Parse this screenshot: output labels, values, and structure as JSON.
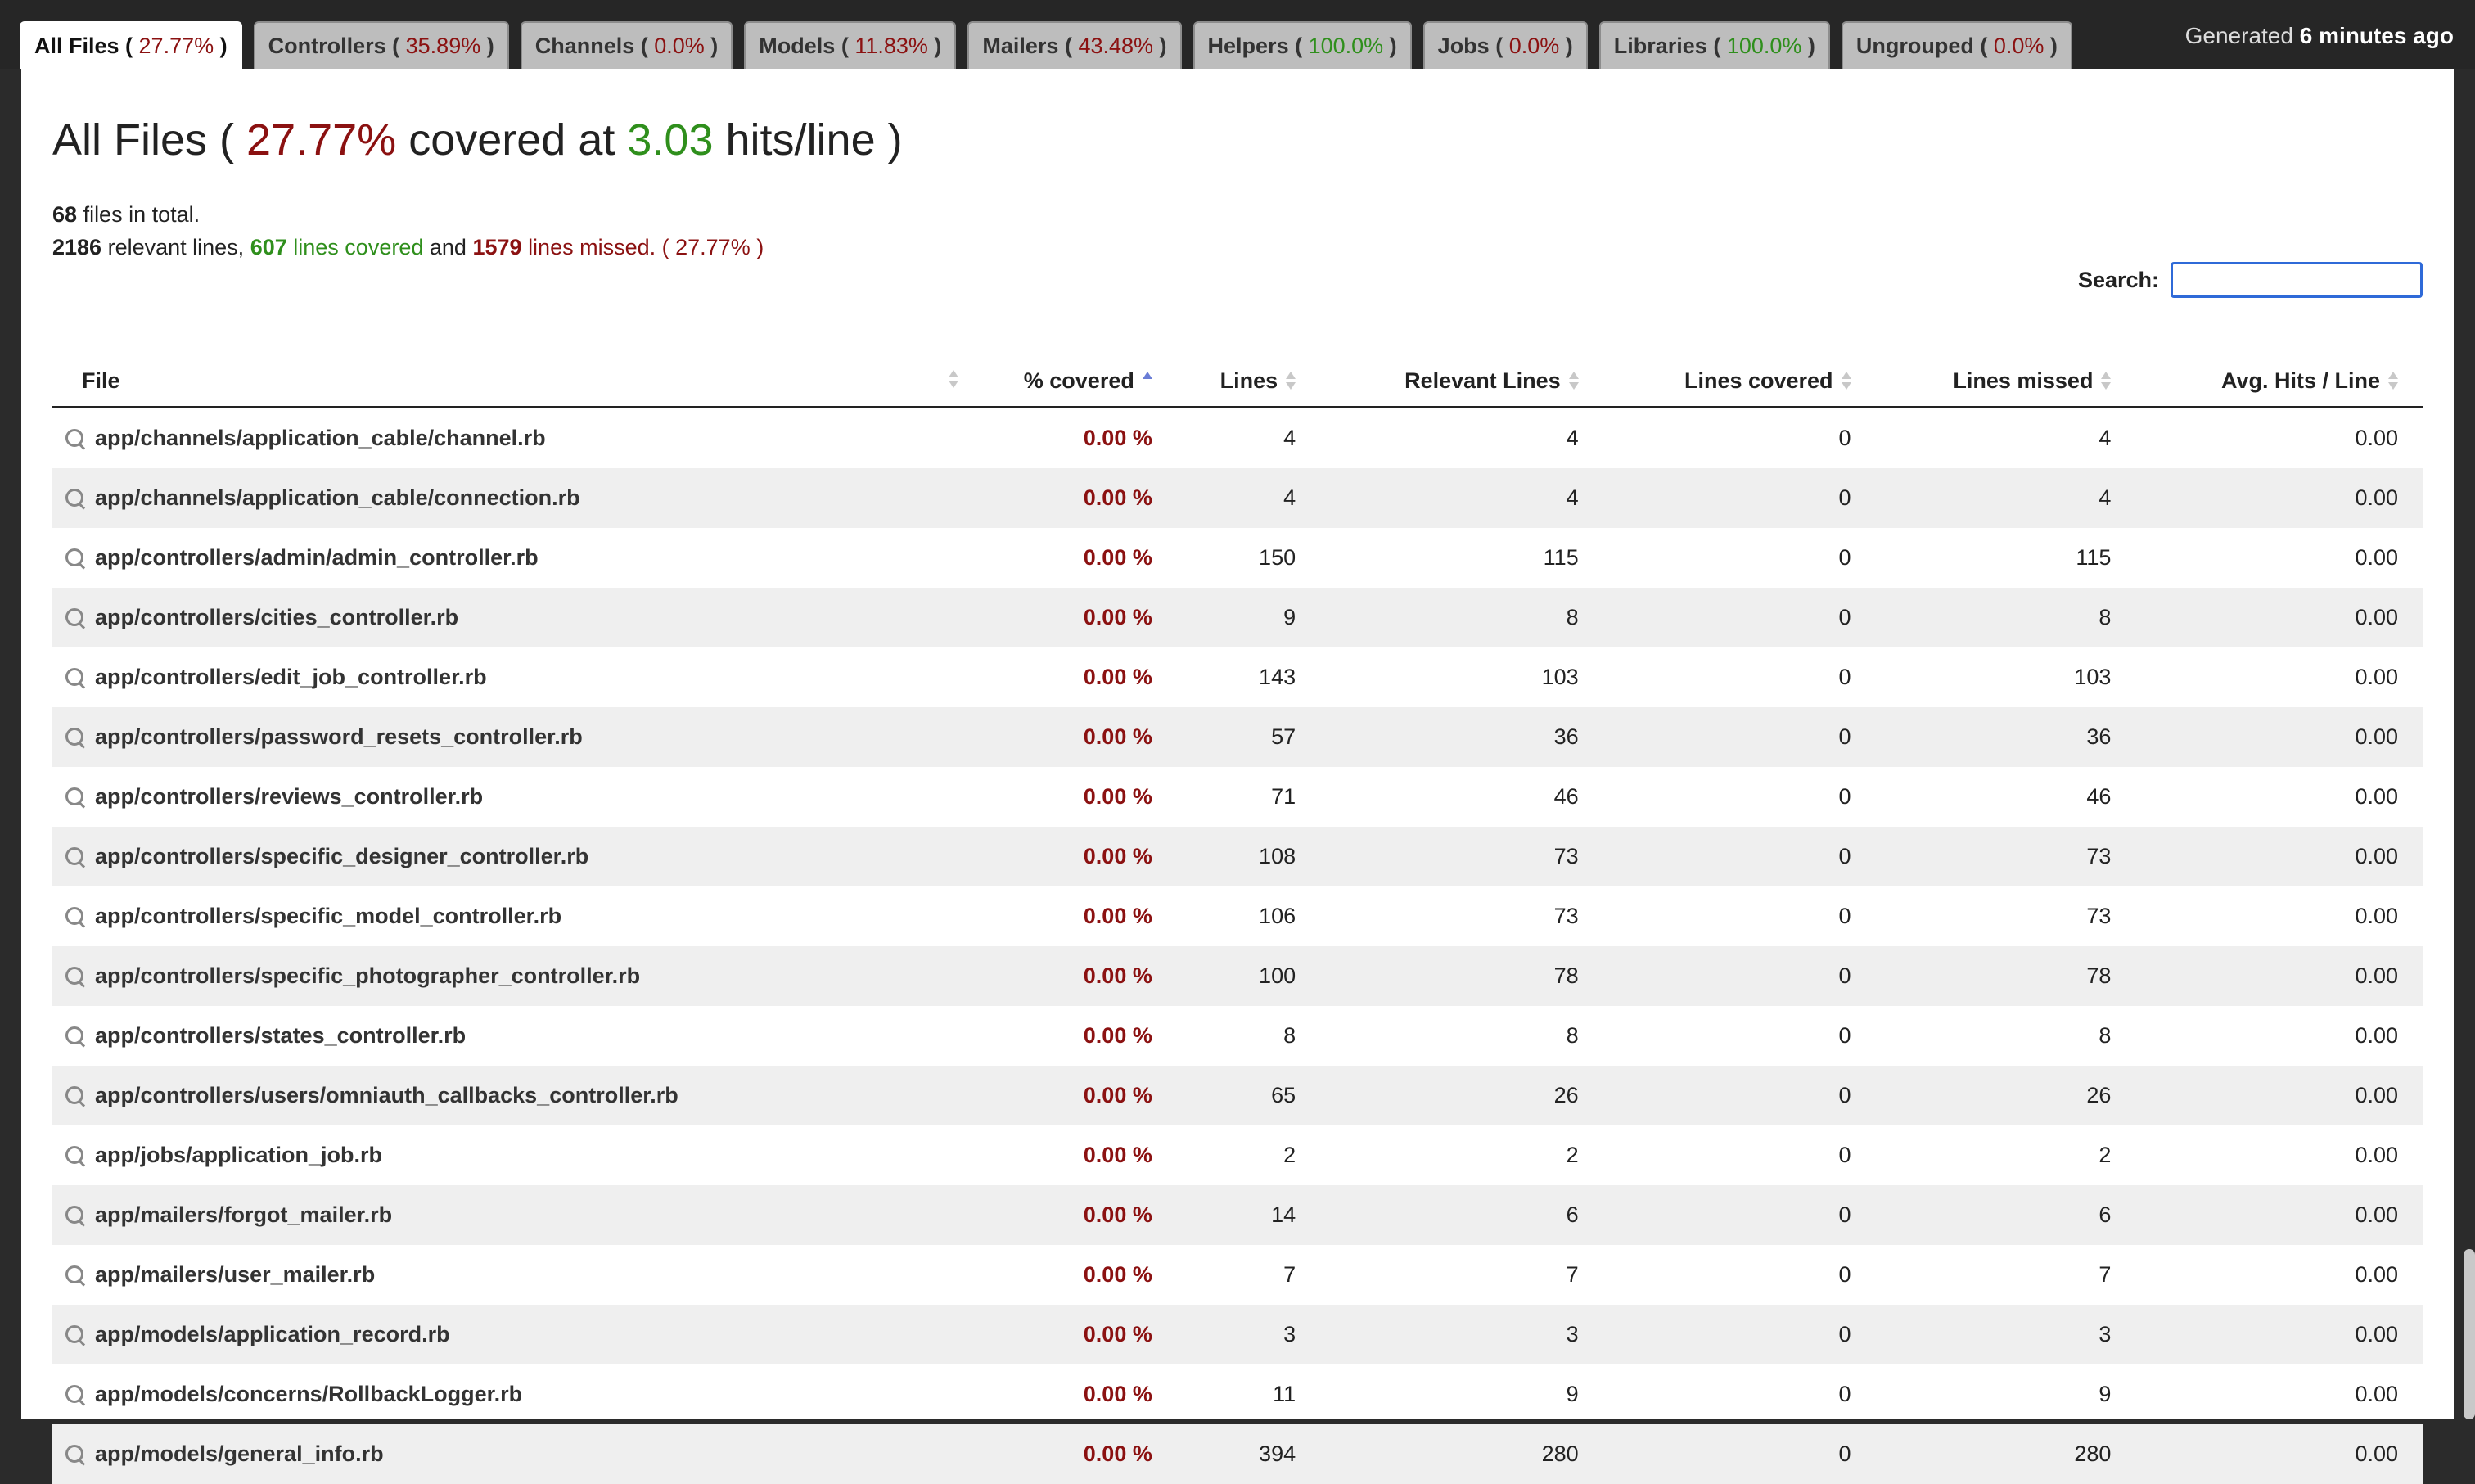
{
  "tabs": [
    {
      "name": "All Files",
      "pct": "27.77%",
      "status": "red",
      "active": true
    },
    {
      "name": "Controllers",
      "pct": "35.89%",
      "status": "red",
      "active": false
    },
    {
      "name": "Channels",
      "pct": "0.0%",
      "status": "red",
      "active": false
    },
    {
      "name": "Models",
      "pct": "11.83%",
      "status": "red",
      "active": false
    },
    {
      "name": "Mailers",
      "pct": "43.48%",
      "status": "red",
      "active": false
    },
    {
      "name": "Helpers",
      "pct": "100.0%",
      "status": "green",
      "active": false
    },
    {
      "name": "Jobs",
      "pct": "0.0%",
      "status": "red",
      "active": false
    },
    {
      "name": "Libraries",
      "pct": "100.0%",
      "status": "green",
      "active": false
    },
    {
      "name": "Ungrouped",
      "pct": "0.0%",
      "status": "red",
      "active": false
    }
  ],
  "generated": {
    "prefix": "Generated",
    "value": "6 minutes ago"
  },
  "heading": {
    "title": "All Files",
    "open": "(",
    "covered_pct": "27.77%",
    "covered_at": "covered at",
    "hits": "3.03",
    "hits_unit": "hits/line",
    "close": ")"
  },
  "summary": {
    "files_count": "68",
    "files_text": "files in total.",
    "relevant_count": "2186",
    "relevant_text": "relevant lines,",
    "covered_count": "607",
    "covered_text": "lines covered",
    "and_text": "and",
    "missed_count": "1579",
    "missed_text": "lines missed.",
    "pct_text": "( 27.77% )"
  },
  "search": {
    "label": "Search:",
    "value": ""
  },
  "columns": {
    "file": "File",
    "covered": "% covered",
    "lines": "Lines",
    "relevant": "Relevant Lines",
    "lines_covered": "Lines covered",
    "lines_missed": "Lines missed",
    "avg_hits": "Avg. Hits / Line"
  },
  "rows": [
    {
      "file": "app/channels/application_cable/channel.rb",
      "covered": "0.00 %",
      "lines": "4",
      "relevant": "4",
      "lines_covered": "0",
      "lines_missed": "4",
      "avg": "0.00"
    },
    {
      "file": "app/channels/application_cable/connection.rb",
      "covered": "0.00 %",
      "lines": "4",
      "relevant": "4",
      "lines_covered": "0",
      "lines_missed": "4",
      "avg": "0.00"
    },
    {
      "file": "app/controllers/admin/admin_controller.rb",
      "covered": "0.00 %",
      "lines": "150",
      "relevant": "115",
      "lines_covered": "0",
      "lines_missed": "115",
      "avg": "0.00"
    },
    {
      "file": "app/controllers/cities_controller.rb",
      "covered": "0.00 %",
      "lines": "9",
      "relevant": "8",
      "lines_covered": "0",
      "lines_missed": "8",
      "avg": "0.00"
    },
    {
      "file": "app/controllers/edit_job_controller.rb",
      "covered": "0.00 %",
      "lines": "143",
      "relevant": "103",
      "lines_covered": "0",
      "lines_missed": "103",
      "avg": "0.00"
    },
    {
      "file": "app/controllers/password_resets_controller.rb",
      "covered": "0.00 %",
      "lines": "57",
      "relevant": "36",
      "lines_covered": "0",
      "lines_missed": "36",
      "avg": "0.00"
    },
    {
      "file": "app/controllers/reviews_controller.rb",
      "covered": "0.00 %",
      "lines": "71",
      "relevant": "46",
      "lines_covered": "0",
      "lines_missed": "46",
      "avg": "0.00"
    },
    {
      "file": "app/controllers/specific_designer_controller.rb",
      "covered": "0.00 %",
      "lines": "108",
      "relevant": "73",
      "lines_covered": "0",
      "lines_missed": "73",
      "avg": "0.00"
    },
    {
      "file": "app/controllers/specific_model_controller.rb",
      "covered": "0.00 %",
      "lines": "106",
      "relevant": "73",
      "lines_covered": "0",
      "lines_missed": "73",
      "avg": "0.00"
    },
    {
      "file": "app/controllers/specific_photographer_controller.rb",
      "covered": "0.00 %",
      "lines": "100",
      "relevant": "78",
      "lines_covered": "0",
      "lines_missed": "78",
      "avg": "0.00"
    },
    {
      "file": "app/controllers/states_controller.rb",
      "covered": "0.00 %",
      "lines": "8",
      "relevant": "8",
      "lines_covered": "0",
      "lines_missed": "8",
      "avg": "0.00"
    },
    {
      "file": "app/controllers/users/omniauth_callbacks_controller.rb",
      "covered": "0.00 %",
      "lines": "65",
      "relevant": "26",
      "lines_covered": "0",
      "lines_missed": "26",
      "avg": "0.00"
    },
    {
      "file": "app/jobs/application_job.rb",
      "covered": "0.00 %",
      "lines": "2",
      "relevant": "2",
      "lines_covered": "0",
      "lines_missed": "2",
      "avg": "0.00"
    },
    {
      "file": "app/mailers/forgot_mailer.rb",
      "covered": "0.00 %",
      "lines": "14",
      "relevant": "6",
      "lines_covered": "0",
      "lines_missed": "6",
      "avg": "0.00"
    },
    {
      "file": "app/mailers/user_mailer.rb",
      "covered": "0.00 %",
      "lines": "7",
      "relevant": "7",
      "lines_covered": "0",
      "lines_missed": "7",
      "avg": "0.00"
    },
    {
      "file": "app/models/application_record.rb",
      "covered": "0.00 %",
      "lines": "3",
      "relevant": "3",
      "lines_covered": "0",
      "lines_missed": "3",
      "avg": "0.00"
    },
    {
      "file": "app/models/concerns/RollbackLogger.rb",
      "covered": "0.00 %",
      "lines": "11",
      "relevant": "9",
      "lines_covered": "0",
      "lines_missed": "9",
      "avg": "0.00"
    },
    {
      "file": "app/models/general_info.rb",
      "covered": "0.00 %",
      "lines": "394",
      "relevant": "280",
      "lines_covered": "0",
      "lines_missed": "280",
      "avg": "0.00"
    }
  ],
  "colors": {
    "missed": "#8b1111",
    "covered": "#2f8f1c",
    "search_focus": "#2f6ad8"
  }
}
